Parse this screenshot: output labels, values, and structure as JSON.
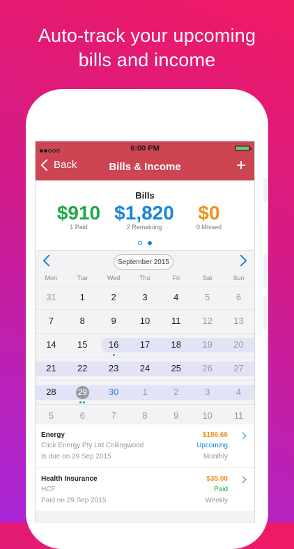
{
  "headline": {
    "line1": "Auto-track your upcoming",
    "line2": "bills and income"
  },
  "status": {
    "time": "6:00 PM"
  },
  "nav": {
    "back": "Back",
    "title": "Bills & Income",
    "add_icon": "plus-icon"
  },
  "summary": {
    "title": "Bills",
    "paid": {
      "amount": "$910",
      "label": "1 Paid",
      "color": "#1fa84a"
    },
    "remaining": {
      "amount": "$1,820",
      "label": "2 Remaining",
      "color": "#1a84d6"
    },
    "missed": {
      "amount": "$0",
      "label": "0 Missed",
      "color": "#f0901e"
    }
  },
  "calendar": {
    "month": "September 2015",
    "weekdays": [
      "Mon",
      "Tue",
      "Wed",
      "Thu",
      "Fri",
      "Sat",
      "Sun"
    ],
    "weeks": [
      [
        "31",
        "1",
        "2",
        "3",
        "4",
        "5",
        "6"
      ],
      [
        "7",
        "8",
        "9",
        "10",
        "11",
        "12",
        "13"
      ],
      [
        "14",
        "15",
        "16",
        "17",
        "18",
        "19",
        "20"
      ],
      [
        "21",
        "22",
        "23",
        "24",
        "25",
        "26",
        "27"
      ],
      [
        "28",
        "29",
        "30",
        "1",
        "2",
        "3",
        "4"
      ],
      [
        "5",
        "6",
        "7",
        "8",
        "9",
        "10",
        "11"
      ]
    ]
  },
  "bills": [
    {
      "name": "Energy",
      "company": "Click Energy Pty Ltd Collingwood",
      "due": "Is due on 29 Sep 2015",
      "amount": "$186.66",
      "status": "Upcoming",
      "frequency": "Monthly"
    },
    {
      "name": "Health Insurance",
      "company": "HCF",
      "due": "Paid on 29 Sep 2015",
      "amount": "$35.00",
      "status": "Paid",
      "frequency": "Weekly"
    }
  ],
  "colors": {
    "navbar": "#cd4453",
    "accent": "#1a84d6",
    "paid": "#1fa84a",
    "upcoming": "#1a84d6",
    "warning": "#f0901e"
  }
}
